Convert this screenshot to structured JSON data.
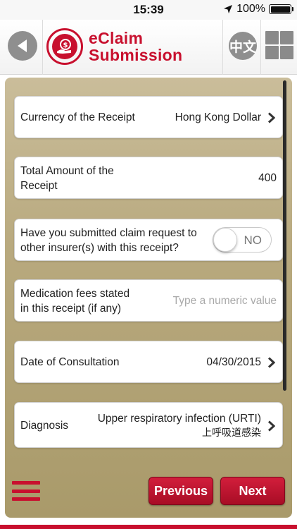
{
  "status_bar": {
    "time": "15:39",
    "battery": "100%"
  },
  "header": {
    "title_line1": "eClaim",
    "title_line2": "Submission",
    "lang_label": "中文"
  },
  "form": {
    "currency": {
      "label": "Currency of the Receipt",
      "value": "Hong Kong Dollar"
    },
    "total": {
      "label_line1": "Total Amount of the",
      "label_line2": "Receipt",
      "value": "400"
    },
    "other_insurer": {
      "label_line1": "Have you submitted claim request to",
      "label_line2": "other insurer(s) with this receipt?",
      "toggle_value": "NO"
    },
    "medication": {
      "label_line1": "Medication fees stated",
      "label_line2": "in this receipt (if any)",
      "placeholder": "Type a numeric value"
    },
    "consultation_date": {
      "label": "Date of Consultation",
      "value": "04/30/2015"
    },
    "diagnosis": {
      "label": "Diagnosis",
      "value_en": "Upper respiratory infection (URTI)",
      "value_zh": "上呼吸道感染"
    }
  },
  "footer": {
    "previous_label": "Previous",
    "next_label": "Next"
  },
  "colors": {
    "brand_red": "#c8102e",
    "panel_gold": "#b8a97e",
    "icon_grey": "#8f8f8f"
  }
}
